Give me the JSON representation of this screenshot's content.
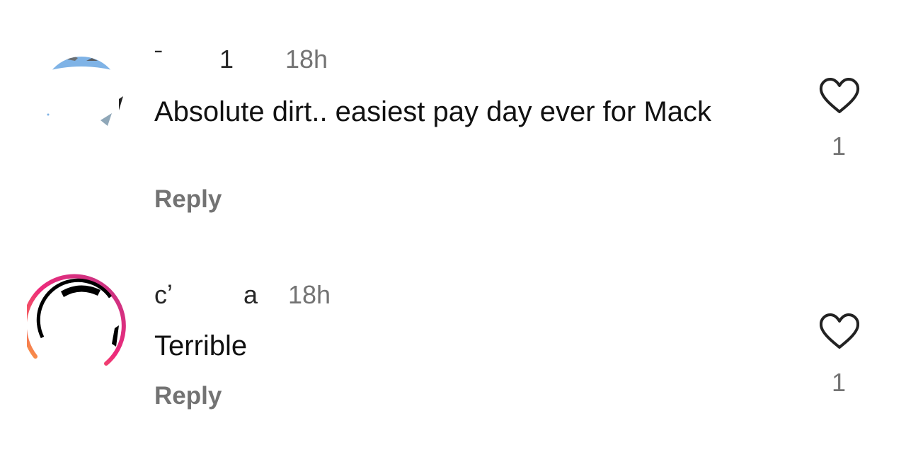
{
  "comments": [
    {
      "username": "ˉ        1",
      "timestamp": "18h",
      "text": "Absolute dirt.. easiest pay day ever for Mack",
      "reply_label": "Reply",
      "like_count": "1",
      "avatar_icon": "profile-photo-sky-icon",
      "has_story_ring": false
    },
    {
      "username": "cʼ          a",
      "timestamp": "18h",
      "text": "Terrible",
      "reply_label": "Reply",
      "like_count": "1",
      "avatar_icon": "profile-photo-story-ring-icon",
      "has_story_ring": true
    }
  ],
  "colors": {
    "text_primary": "#111111",
    "text_secondary": "#737373",
    "story_ring_start": "#f9a03f",
    "story_ring_mid": "#ee2a7b",
    "story_ring_end": "#c13584",
    "sky_blue": "#7fb3e6"
  },
  "icons": {
    "like": "heart-outline-icon"
  }
}
